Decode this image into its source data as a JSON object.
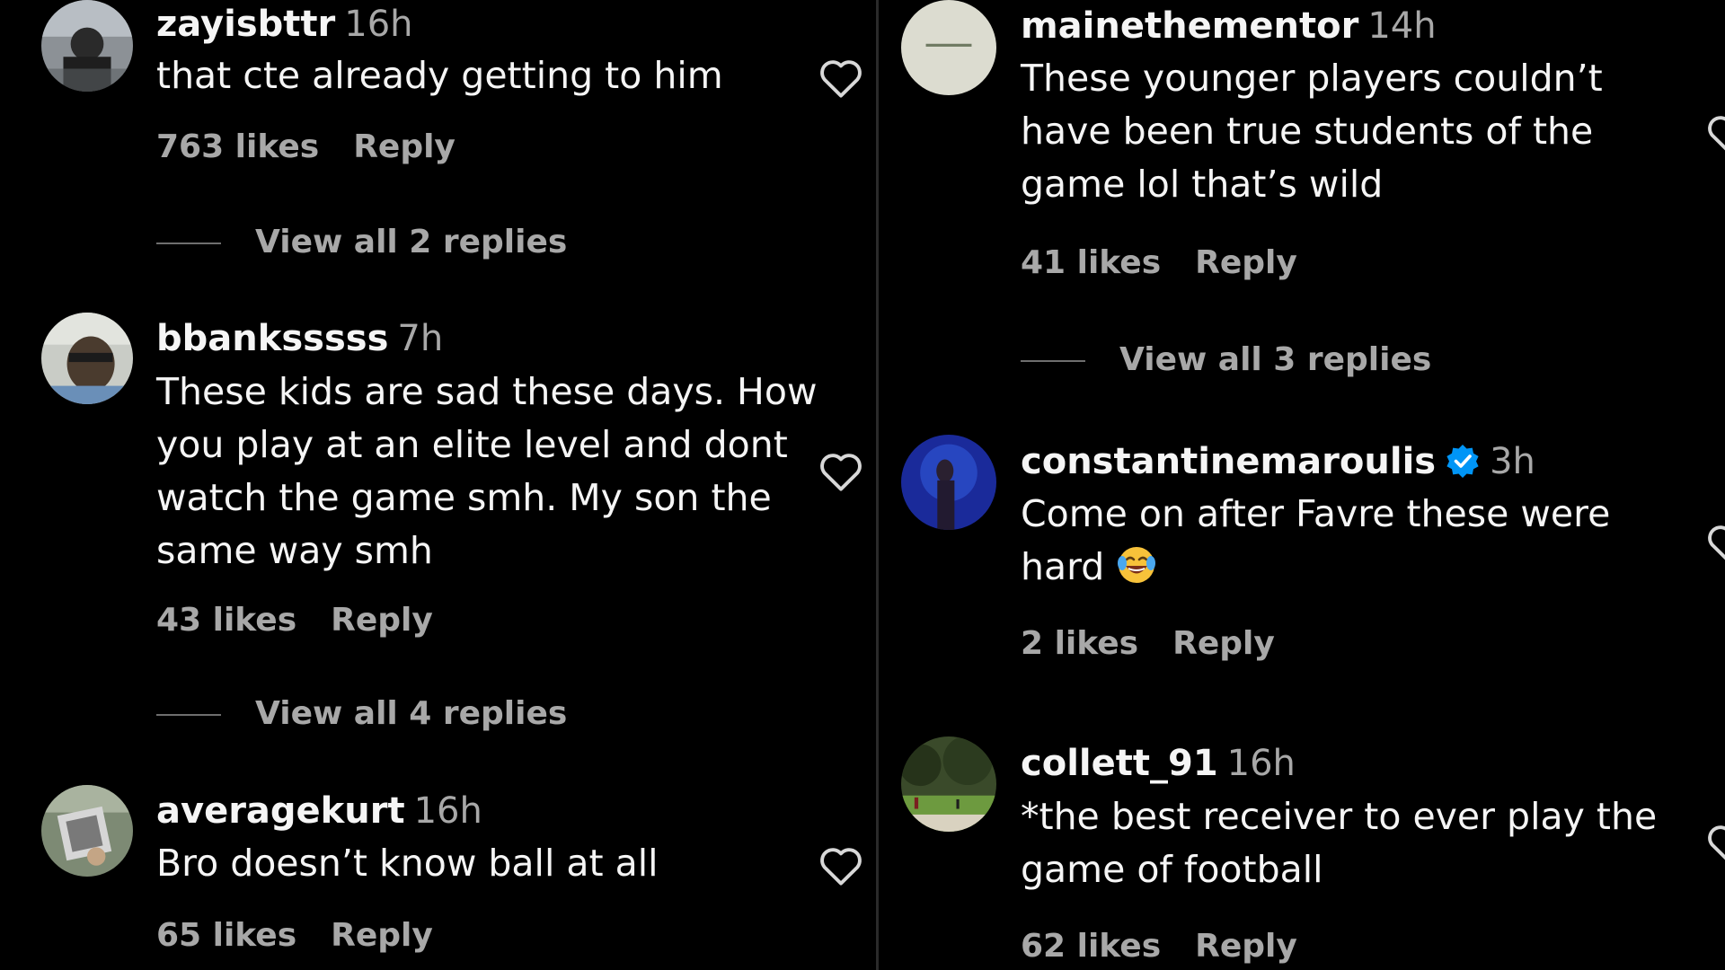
{
  "left_column": {
    "comments": [
      {
        "username": "zayisbttr",
        "time": "16h",
        "text": "that cte already getting to him",
        "likes": "763 likes",
        "reply_label": "Reply",
        "view_replies": "View all 2 replies",
        "avatar_icon": "profile-photo"
      },
      {
        "username": "bbanksssss",
        "time": "7h",
        "text": "These kids are sad these days. How\nyou play at an elite level and dont\nwatch the game smh. My son the\nsame way smh",
        "likes": "43 likes",
        "reply_label": "Reply",
        "view_replies": "View all 4 replies",
        "avatar_icon": "profile-photo"
      },
      {
        "username": "averagekurt",
        "time": "16h",
        "text": "Bro doesn’t know ball at all",
        "likes": "65 likes",
        "reply_label": "Reply",
        "avatar_icon": "profile-photo"
      }
    ]
  },
  "right_column": {
    "comments": [
      {
        "username": "mainethementor",
        "time": "14h",
        "text": "These younger players couldn’t\nhave been true students of the\ngame lol that’s wild",
        "likes": "41 likes",
        "reply_label": "Reply",
        "view_replies": "View all 3 replies",
        "avatar_icon": "profile-photo"
      },
      {
        "username": "constantinemaroulis",
        "time": "3h",
        "verified": true,
        "text_line1": "Come on after Favre these were",
        "text_line2": "hard",
        "emoji": "laughing-crying-emoji",
        "likes": "2 likes",
        "reply_label": "Reply",
        "avatar_icon": "profile-photo"
      },
      {
        "username": "collett_91",
        "time": "16h",
        "text": "*the best receiver to ever play the\ngame of football",
        "likes": "62 likes",
        "reply_label": "Reply",
        "avatar_icon": "profile-photo"
      }
    ]
  },
  "icons": {
    "like": "heart-outline-icon",
    "verified": "verified-badge-icon"
  },
  "colors": {
    "background": "#000000",
    "primary_text": "#f5f5f5",
    "secondary_text": "#a8a8a8",
    "verified_blue": "#0095f6",
    "divider": "#2a2a2a"
  }
}
